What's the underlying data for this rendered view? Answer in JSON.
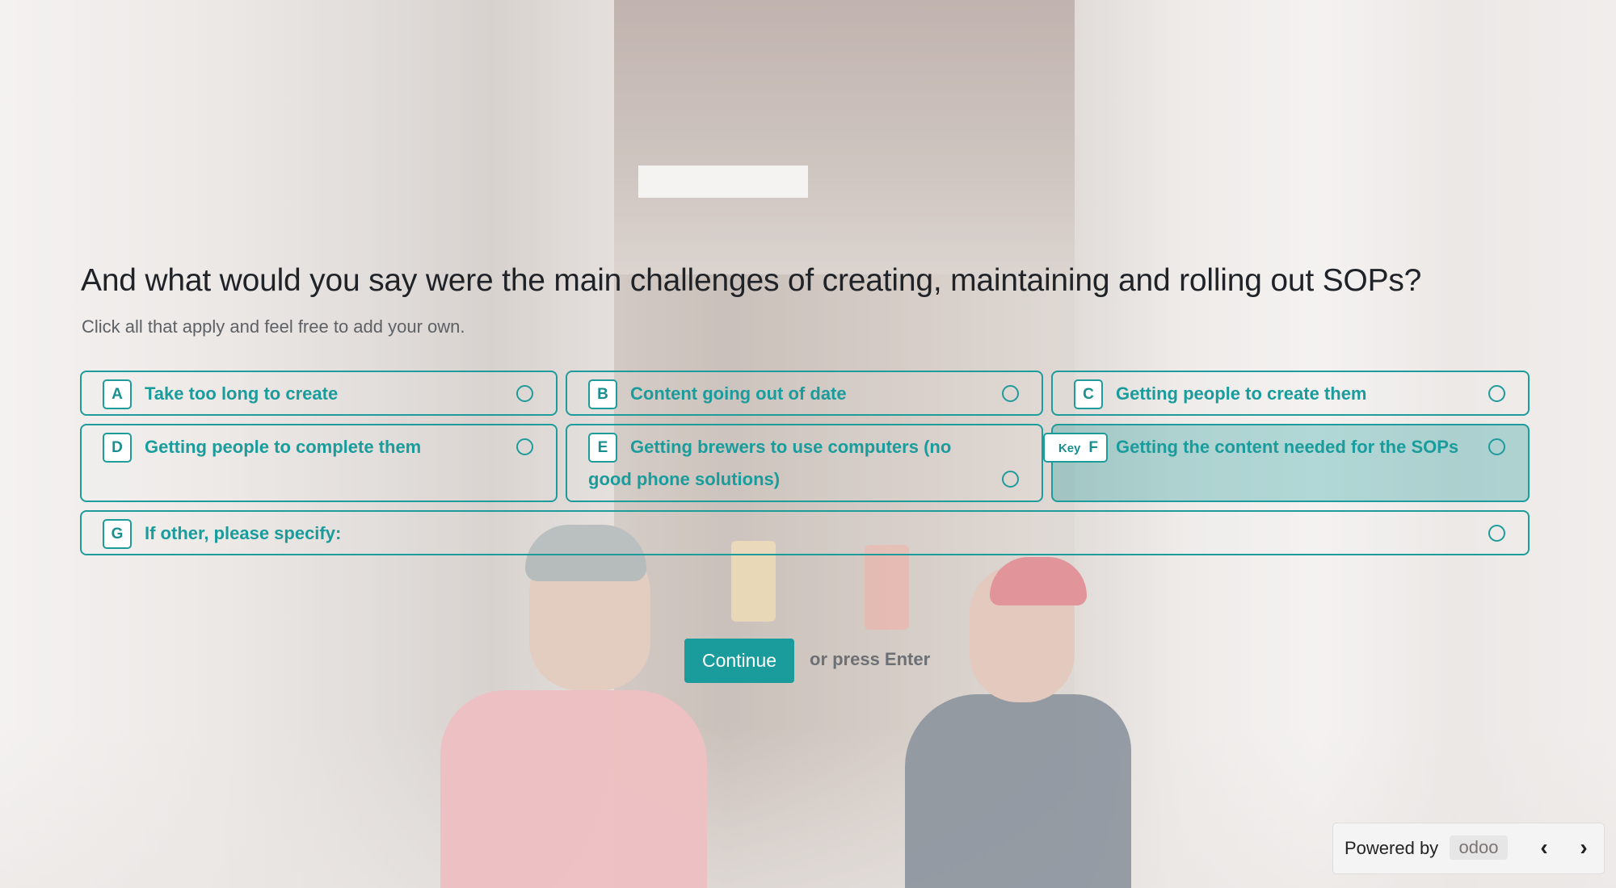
{
  "question": {
    "title": "And what would you say were the main challenges of creating, maintaining and rolling out SOPs?",
    "description": "Click all that apply and feel free to add your own."
  },
  "choices": [
    {
      "key": "A",
      "label": "Take too long to create",
      "selected": false
    },
    {
      "key": "B",
      "label": "Content going out of date",
      "selected": false
    },
    {
      "key": "C",
      "label": "Getting people to create them",
      "selected": false
    },
    {
      "key": "D",
      "label": "Getting people to complete them",
      "selected": false
    },
    {
      "key": "E",
      "label": "Getting brewers to use computers (no good phone solutions)",
      "selected": false
    },
    {
      "key": "F",
      "key_hint": "Key",
      "label": "Getting the content needed for the SOPs",
      "selected": true
    },
    {
      "key": "G",
      "label": "If other, please specify:",
      "selected": false
    }
  ],
  "actions": {
    "continue_label": "Continue",
    "press_enter": "or press Enter"
  },
  "footer": {
    "powered_by": "Powered by",
    "logo_text": "odoo",
    "prev_icon": "chevron-left-icon",
    "next_icon": "chevron-right-icon"
  },
  "colors": {
    "accent": "#1a9c9c",
    "title": "#1f2328",
    "muted": "#5d6166"
  }
}
